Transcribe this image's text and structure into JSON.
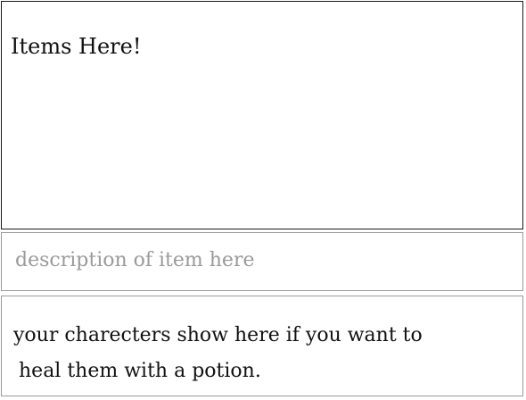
{
  "items_panel": {
    "title": "Items Here!"
  },
  "description_panel": {
    "text": "description of item here"
  },
  "characters_panel": {
    "line1": "your charecters show here if you want to",
    "line2": "heal them with a potion."
  }
}
